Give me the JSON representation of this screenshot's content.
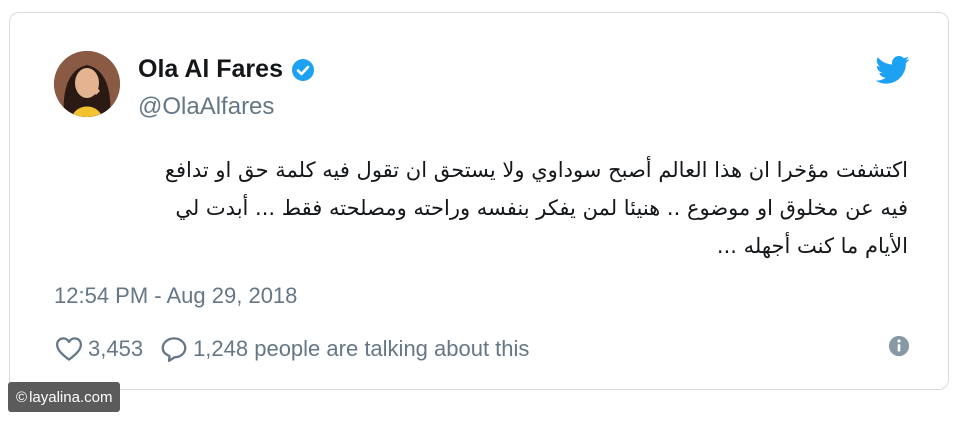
{
  "user": {
    "name": "Ola Al Fares",
    "handle": "@OlaAlfares",
    "avatar_icon": "profile-photo",
    "verified_icon": "verified-badge-icon"
  },
  "tweet": {
    "lines": [
      "اكتشفت مؤخرا ان هذا العالم  أصبح سوداوي ولا يستحق ان تقول فيه كلمة حق او تدافع",
      "فيه عن مخلوق  او موضوع .. هنيئا لمن يفكر بنفسه وراحته ومصلحته فقط ... أبدت لي",
      "الأيام ما كنت أجهله ..."
    ],
    "timestamp": "12:54 PM - Aug 29, 2018"
  },
  "actions": {
    "likes": "3,453",
    "replies": "1,248 people are talking about this"
  },
  "watermark": {
    "symbol": "©",
    "text": "layalina.com"
  },
  "colors": {
    "twitter_blue": "#1da1f2",
    "text": "#14171a",
    "secondary": "#657786",
    "border": "#d6dce1"
  }
}
